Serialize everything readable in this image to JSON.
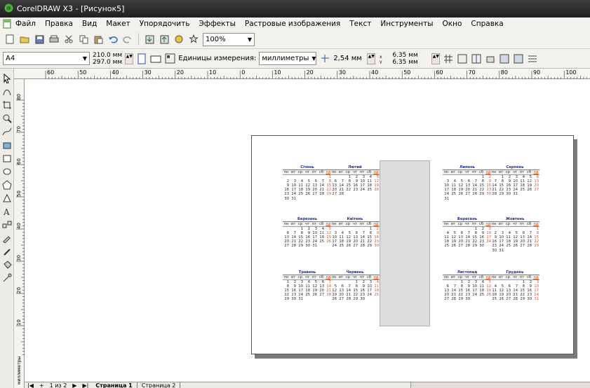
{
  "window": {
    "title": "CorelDRAW X3 - [Рисунок5]"
  },
  "menu": [
    {
      "label": "Файл"
    },
    {
      "label": "Правка"
    },
    {
      "label": "Вид"
    },
    {
      "label": "Макет"
    },
    {
      "label": "Упорядочить"
    },
    {
      "label": "Эффекты"
    },
    {
      "label": "Растровые изображения"
    },
    {
      "label": "Текст"
    },
    {
      "label": "Инструменты"
    },
    {
      "label": "Окно"
    },
    {
      "label": "Справка"
    }
  ],
  "toolbar": {
    "zoom": "100%"
  },
  "propertybar": {
    "paper": "A4",
    "width": "210.0 мм",
    "height": "297.0 мм",
    "units_label": "Единицы измерения:",
    "units_value": "миллиметры",
    "nudge": "2,54 мм",
    "dup_x": "6.35 мм",
    "dup_y": "6.35 мм"
  },
  "ruler": {
    "top_labels": [
      "60",
      "50",
      "40",
      "30",
      "20",
      "10",
      "0",
      "10",
      "20",
      "30",
      "40",
      "50",
      "60",
      "70",
      "80",
      "90",
      "100"
    ],
    "left_labels": [
      "80",
      "70",
      "60",
      "50",
      "40",
      "30",
      "20",
      "10"
    ],
    "left_units": "миллиметры"
  },
  "tabs": {
    "page_count": "1 из 2",
    "pages": [
      {
        "label": "Страница 1"
      },
      {
        "label": "Страница 2"
      }
    ]
  },
  "calendar": {
    "weekdays": [
      "пн",
      "вт",
      "ср",
      "чт",
      "пт",
      "сб",
      "нд"
    ],
    "months": [
      {
        "name": "Січень",
        "start": 6,
        "days": 31
      },
      {
        "name": "Лютий",
        "start": 2,
        "days": 28
      },
      {
        "name": "Березень",
        "start": 2,
        "days": 31
      },
      {
        "name": "Квітень",
        "start": 5,
        "days": 30
      },
      {
        "name": "Травень",
        "start": 0,
        "days": 31
      },
      {
        "name": "Червень",
        "start": 3,
        "days": 30
      },
      {
        "name": "Липень",
        "start": 5,
        "days": 31
      },
      {
        "name": "Серпень",
        "start": 1,
        "days": 31
      },
      {
        "name": "Вересень",
        "start": 4,
        "days": 30
      },
      {
        "name": "Жовтень",
        "start": 6,
        "days": 31
      },
      {
        "name": "Листопад",
        "start": 2,
        "days": 30
      },
      {
        "name": "Грудень",
        "start": 4,
        "days": 31
      }
    ]
  }
}
